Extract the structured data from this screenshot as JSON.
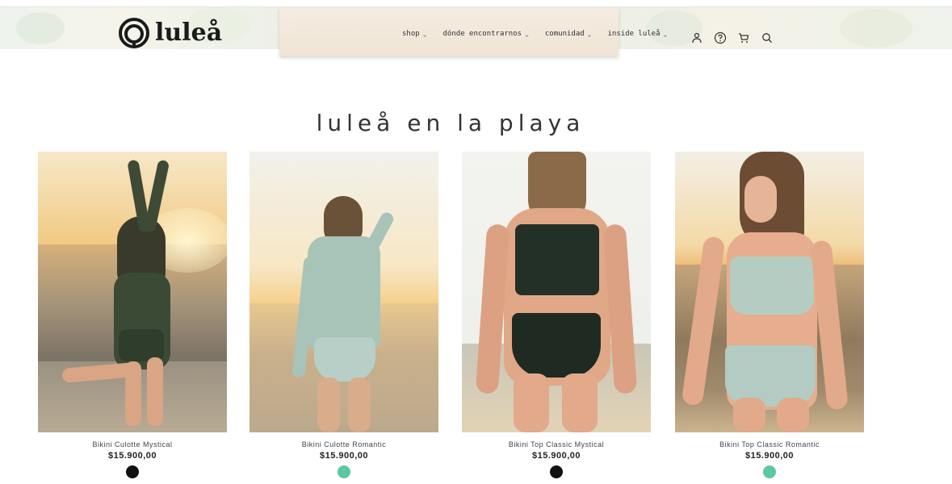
{
  "brand": {
    "name": "luleå"
  },
  "nav": {
    "items": [
      {
        "label": "shop"
      },
      {
        "label": "dónde encontrarnos"
      },
      {
        "label": "comunidad"
      },
      {
        "label": "inside luleå"
      }
    ]
  },
  "header_icons": [
    "account-icon",
    "help-icon",
    "cart-icon",
    "search-icon"
  ],
  "page": {
    "title": "luleå en la playa"
  },
  "products": [
    {
      "name": "Bikini Culotte Mystical",
      "price": "$15.900,00",
      "swatch_color": "#111111"
    },
    {
      "name": "Bikini Culotte Romantic",
      "price": "$15.900,00",
      "swatch_color": "#5cc7a3"
    },
    {
      "name": "Bikini Top Classic Mystical",
      "price": "$15.900,00",
      "swatch_color": "#111111"
    },
    {
      "name": "Bikini Top Classic Romantic",
      "price": "$15.900,00",
      "swatch_color": "#5cc7a3"
    }
  ],
  "colors": {
    "mint": "#5cc7a3",
    "black": "#111111"
  }
}
